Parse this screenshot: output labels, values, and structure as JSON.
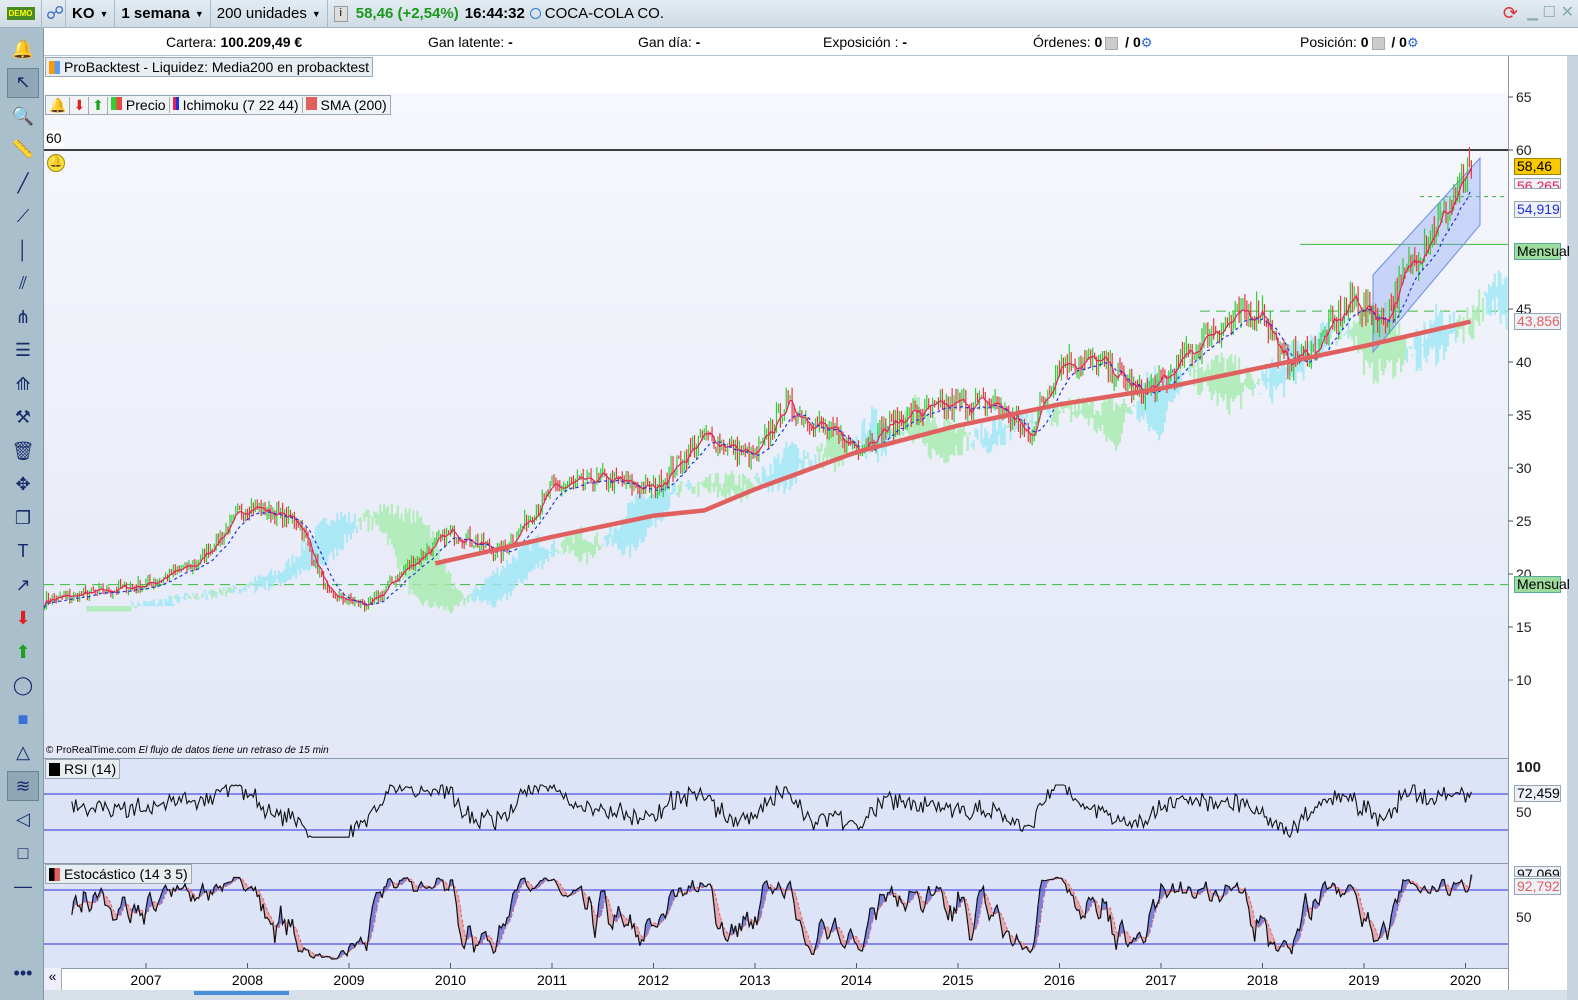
{
  "topbar": {
    "demo_label": "DEMO",
    "symbol": "KO",
    "timeframe": "1 semana",
    "units": "200 unidades",
    "last_price": "58,46 (+2,54%)",
    "time": "16:44:32",
    "instrument": "COCA-COLA CO."
  },
  "infobar": {
    "cartera_label": "Cartera:",
    "cartera_value": "100.209,49 €",
    "gan_latente_label": "Gan latente:",
    "gan_latente_value": "-",
    "gan_dia_label": "Gan día:",
    "gan_dia_value": "-",
    "exposicion_label": "Exposición :",
    "exposicion_value": "-",
    "ordenes_label": "Órdenes:",
    "ordenes_value": "0",
    "ordenes_total": "/ 0",
    "posicion_label": "Posición:",
    "posicion_value": "0",
    "posicion_total": "/ 0"
  },
  "backtest_label": "ProBacktest - Liquidez: Media200 en probacktest",
  "legend": {
    "precio": "Precio",
    "ichimoku": "Ichimoku (7 22 44)",
    "sma": "SMA (200)",
    "rsi": "RSI (14)",
    "stoch": "Estocástico (14 3 5)"
  },
  "alert_level": "60",
  "copyright": "© ProRealTime.com",
  "delay_note": "El flujo de datos tiene un retraso de 15 min",
  "price_labels": {
    "last": "58,46",
    "tenkan": "56,265",
    "kijun": "54,919",
    "mensual1": "Mensual",
    "sma": "43,856",
    "mensual2": "Mensual"
  },
  "rsi_labels": {
    "top": "100",
    "mid": "50",
    "value": "72,459"
  },
  "stoch_labels": {
    "k": "97,069",
    "d": "92,792",
    "mid": "50"
  },
  "left_tools": [
    "bell-icon",
    "cursor-icon",
    "zoom-icon",
    "ruler-icon",
    "line-icon",
    "segment-icon",
    "vertical-line-icon",
    "channel-icon",
    "fork-icon",
    "fibonacci-icon",
    "gann-icon",
    "tools-icon",
    "trash-icon",
    "move-icon",
    "copy-icon",
    "text-icon",
    "arrow-icon",
    "down-arrow-icon",
    "up-arrow-icon",
    "ellipse-icon",
    "rectangle-icon",
    "triangle-icon",
    "trend-channel-icon",
    "wedge-icon",
    "square-icon",
    "hline-icon",
    "more-icon"
  ],
  "colors": {
    "up": "#33cc33",
    "down": "#e23a3a",
    "sma": "#e06060",
    "tenkan": "#e8205a",
    "kijun": "#2030e0",
    "cloud_up": "#9fe8f6",
    "cloud_down": "#a8ecb0",
    "channel": "#7a9cf0"
  },
  "chart_data": {
    "type": "candlestick",
    "title": "COCA-COLA CO. (KO) 1 semana",
    "x_ticks": [
      "2007",
      "2008",
      "2009",
      "2010",
      "2011",
      "2012",
      "2013",
      "2014",
      "2015",
      "2016",
      "2017",
      "2018",
      "2019",
      "2020"
    ],
    "y_ticks": [
      "10",
      "15",
      "20",
      "25",
      "30",
      "35",
      "40",
      "45",
      "60",
      "65"
    ],
    "ylim": [
      5,
      65
    ],
    "price_anchors": [
      [
        2006.0,
        17.5
      ],
      [
        2007.0,
        19
      ],
      [
        2007.5,
        21
      ],
      [
        2008.0,
        26.5
      ],
      [
        2008.5,
        25
      ],
      [
        2008.8,
        18
      ],
      [
        2009.2,
        17
      ],
      [
        2009.5,
        20
      ],
      [
        2010.0,
        24
      ],
      [
        2010.5,
        22
      ],
      [
        2011.0,
        28
      ],
      [
        2011.5,
        29
      ],
      [
        2012.0,
        28
      ],
      [
        2012.5,
        33
      ],
      [
        2013.0,
        31
      ],
      [
        2013.3,
        36
      ],
      [
        2013.8,
        33
      ],
      [
        2014.0,
        32
      ],
      [
        2014.5,
        35
      ],
      [
        2015.0,
        36
      ],
      [
        2015.4,
        36
      ],
      [
        2015.7,
        33
      ],
      [
        2016.0,
        40
      ],
      [
        2016.4,
        40
      ],
      [
        2016.8,
        37
      ],
      [
        2017.0,
        38
      ],
      [
        2017.5,
        43
      ],
      [
        2018.0,
        45
      ],
      [
        2018.2,
        40
      ],
      [
        2018.5,
        41
      ],
      [
        2018.9,
        46
      ],
      [
        2019.0,
        45
      ],
      [
        2019.2,
        44
      ],
      [
        2019.5,
        50
      ],
      [
        2019.8,
        54
      ],
      [
        2020.07,
        58.46
      ]
    ],
    "sma200": [
      [
        2009.85,
        21
      ],
      [
        2011,
        23.5
      ],
      [
        2012,
        25.5
      ],
      [
        2012.5,
        26
      ],
      [
        2013,
        28
      ],
      [
        2014,
        31.5
      ],
      [
        2015,
        34
      ],
      [
        2016,
        36
      ],
      [
        2017,
        37.5
      ],
      [
        2018,
        39.5
      ],
      [
        2019,
        41.5
      ],
      [
        2020.07,
        43.856
      ]
    ],
    "horizontal_levels": {
      "alert": 60,
      "mensual_upper": 51.1,
      "mensual_lower": 19,
      "dashed_1": 55.6,
      "dashed_2": 44.8
    },
    "rsi": {
      "last": 72.459,
      "levels": [
        70,
        30
      ]
    },
    "stochastic": {
      "k": 97.069,
      "d": 92.792,
      "levels": [
        80,
        20
      ]
    }
  }
}
